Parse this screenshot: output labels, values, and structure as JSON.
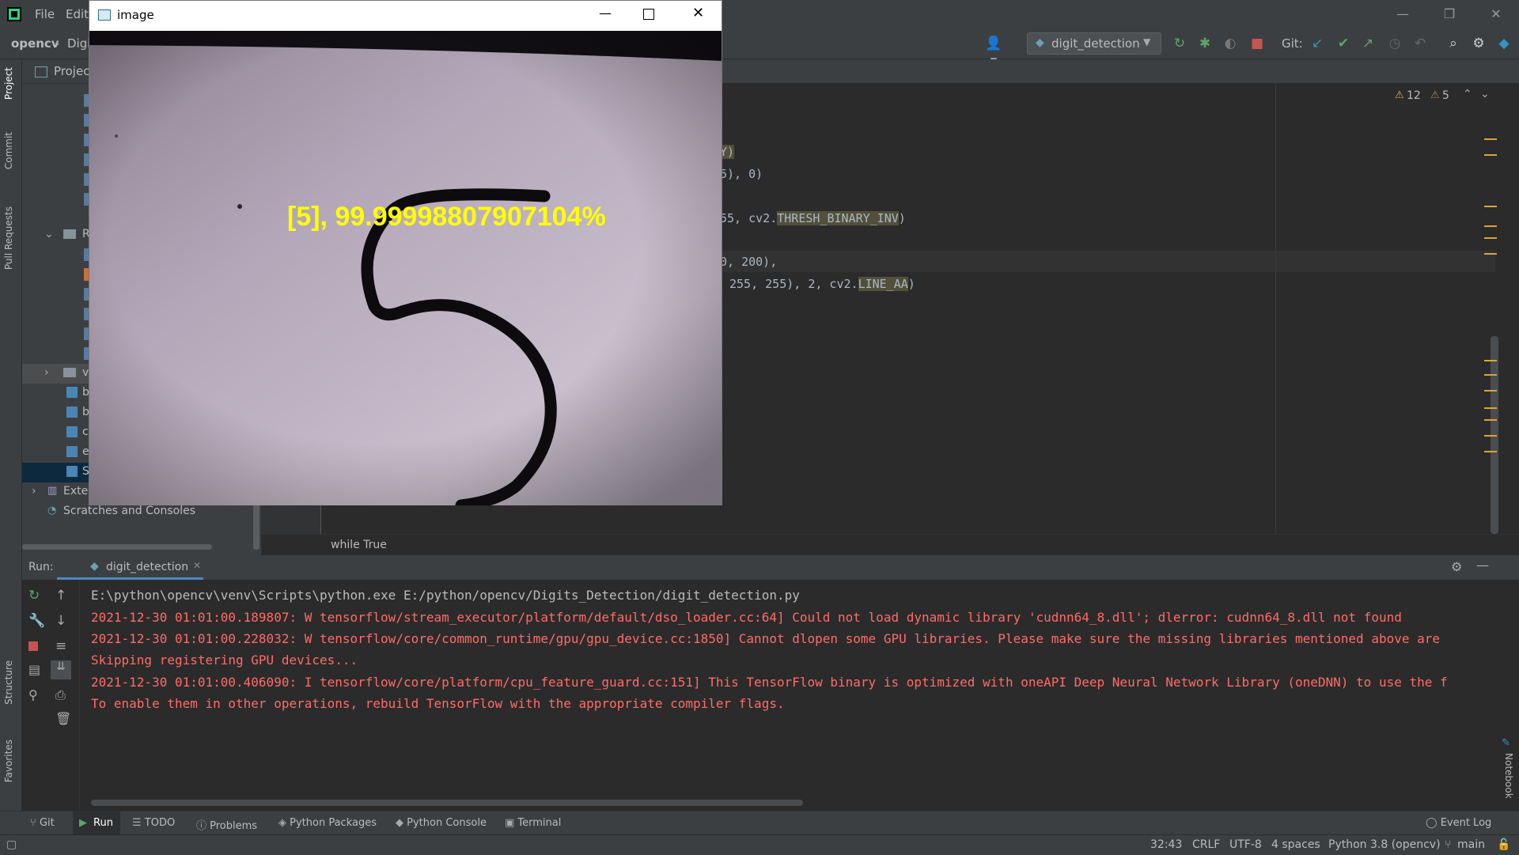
{
  "menu": {
    "file": "File",
    "edit": "Edit"
  },
  "toolbar": {
    "breadcrumb_root": "opencv",
    "breadcrumb_child": "Digi",
    "run_config": "digit_detection",
    "git_label": "Git:"
  },
  "sidebar": {
    "tabs": [
      "Project",
      "Commit",
      "Pull Requests",
      "Structure",
      "Favorites"
    ]
  },
  "project": {
    "header": "Project",
    "folder_r": "R",
    "folder_v": "v",
    "files": [
      "b",
      "b",
      "c",
      "e",
      "S"
    ],
    "external_libraries": "External Libraries",
    "scratches": "Scratches and Consoles"
  },
  "editor": {
    "warnings": "12",
    "weak_warnings": "5",
    "lines": [
      {
        "pre": "Y)",
        "rest": ""
      },
      {
        "pre": "5), 0)",
        "rest": ""
      },
      {
        "pre": "55, cv2.",
        "hl": "THRESH_BINARY_INV",
        "post": ")"
      },
      {
        "pre": "0, 200),",
        "rest": ""
      },
      {
        "pre": "255, 255), 2, cv2.",
        "hl": "LINE_AA",
        "post": ")"
      }
    ],
    "breadcrumb": "while True"
  },
  "run": {
    "label": "Run:",
    "tab": "digit_detection",
    "console": [
      {
        "text": "E:\\python\\opencv\\venv\\Scripts\\python.exe E:/python/opencv/Digits_Detection/digit_detection.py",
        "type": "cmd"
      },
      {
        "text": "2021-12-30 01:01:00.189807: W tensorflow/stream_executor/platform/default/dso_loader.cc:64] Could not load dynamic library 'cudnn64_8.dll'; dlerror: cudnn64_8.dll not found",
        "type": "err"
      },
      {
        "text": "2021-12-30 01:01:00.228032: W tensorflow/core/common_runtime/gpu/gpu_device.cc:1850] Cannot dlopen some GPU libraries. Please make sure the missing libraries mentioned above are",
        "type": "err"
      },
      {
        "text": "Skipping registering GPU devices...",
        "type": "err"
      },
      {
        "text": "2021-12-30 01:01:00.406090: I tensorflow/core/platform/cpu_feature_guard.cc:151] This TensorFlow binary is optimized with oneAPI Deep Neural Network Library (oneDNN) to use the f",
        "type": "err"
      },
      {
        "text": "To enable them in other operations, rebuild TensorFlow with the appropriate compiler flags.",
        "type": "err"
      }
    ]
  },
  "bottom_tools": [
    "Git",
    "Run",
    "TODO",
    "Problems",
    "Python Packages",
    "Python Console",
    "Terminal",
    "Event Log"
  ],
  "right_stripe": "Notebook",
  "status": {
    "position": "32:43",
    "line_sep": "CRLF",
    "encoding": "UTF-8",
    "indent": "4 spaces",
    "interpreter": "Python 3.8 (opencv)",
    "branch": "main"
  },
  "image_window": {
    "title": "image",
    "prediction": "[5], 99.99998807907104%"
  },
  "colors": {
    "console_err": "#ff6b68",
    "console_cmd": "#bbbbbb",
    "prediction": "#ffff00"
  }
}
